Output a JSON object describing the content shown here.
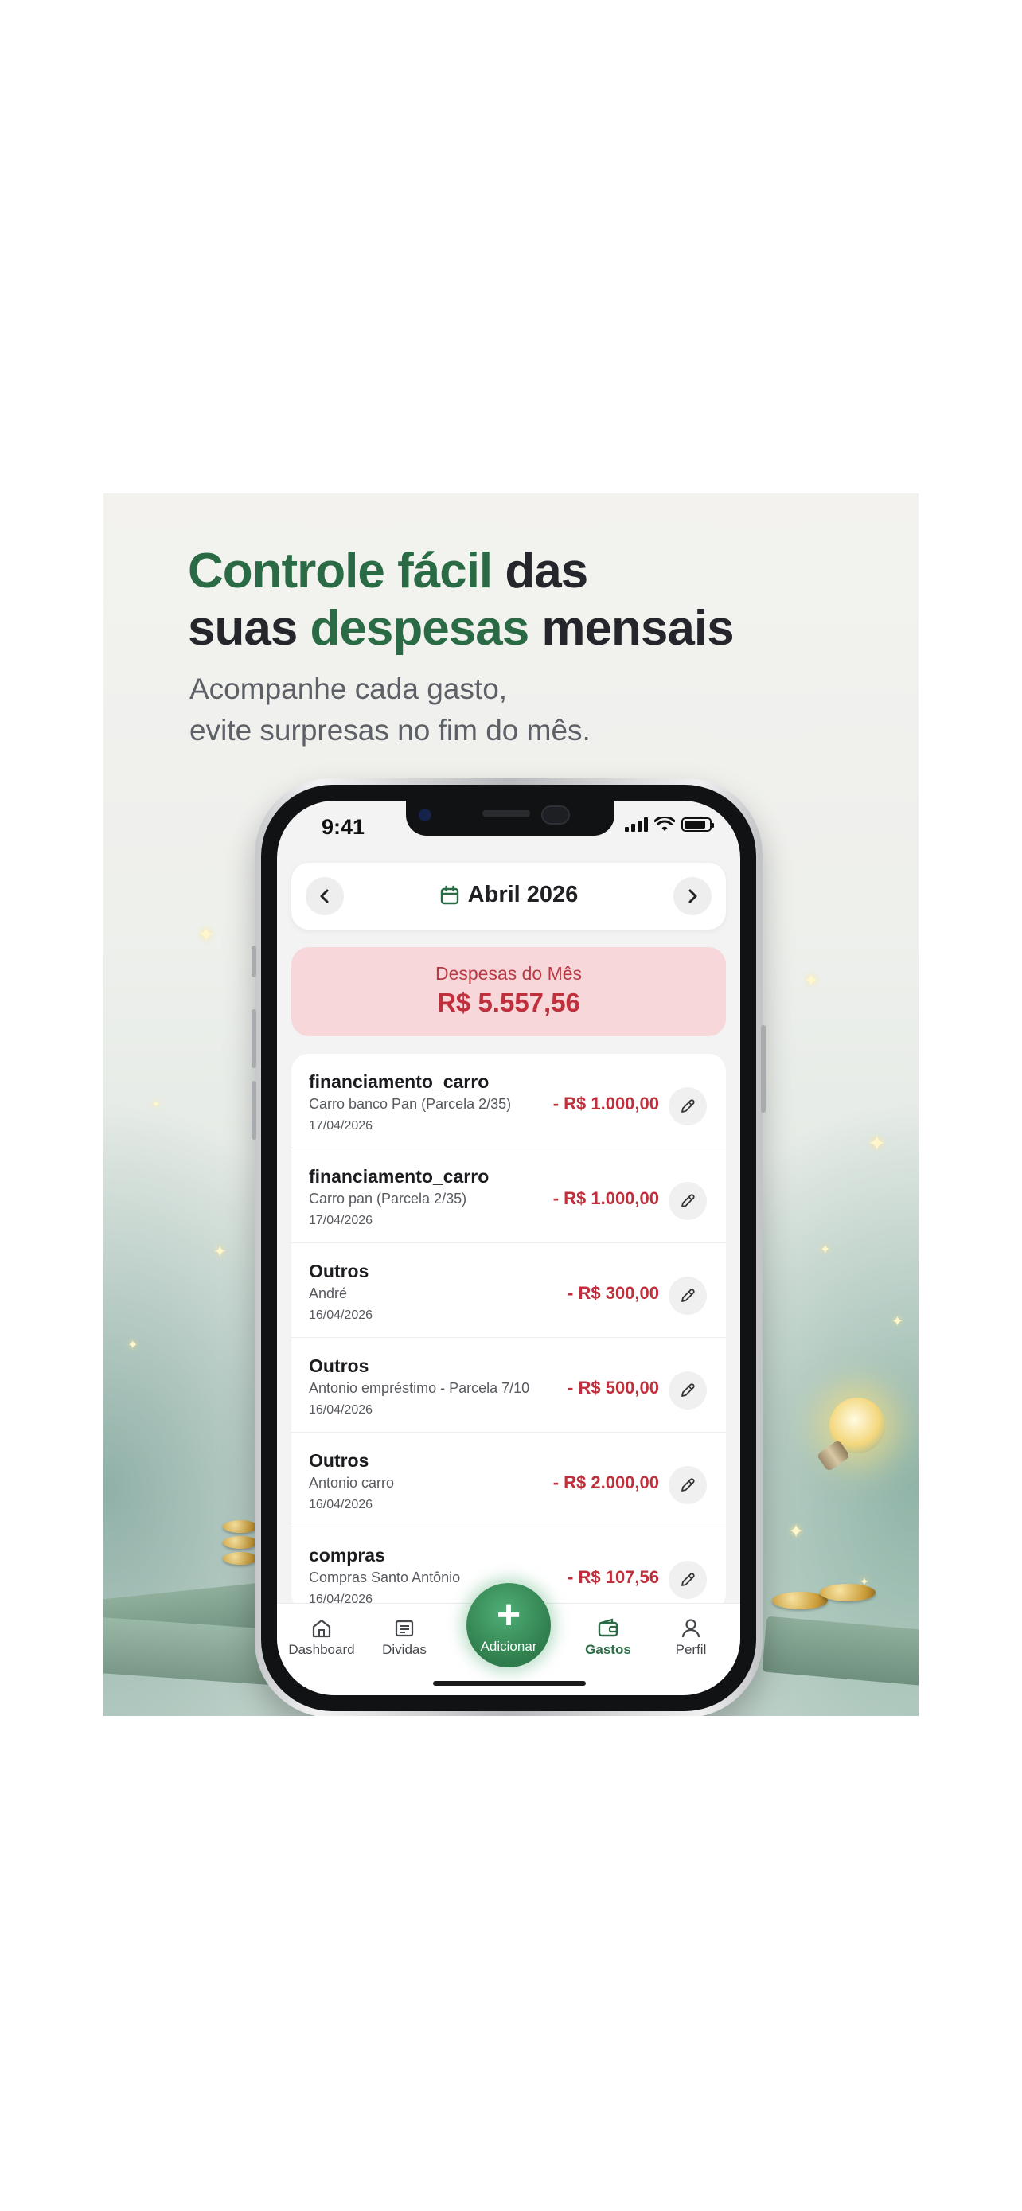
{
  "headline": {
    "line1_green": "Controle fácil",
    "line1_dark": " das",
    "line2_dark_a": "suas ",
    "line2_green": "despesas",
    "line2_dark_b": " mensais"
  },
  "subline": {
    "line1": "Acompanhe cada gasto,",
    "line2": "evite surpresas no fim do mês."
  },
  "status_bar": {
    "time": "9:41"
  },
  "month_nav": {
    "prev_icon": "chevron-left-icon",
    "next_icon": "chevron-right-icon",
    "calendar_icon": "calendar-icon",
    "label": "Abril 2026"
  },
  "summary": {
    "label": "Despesas do Mês",
    "amount": "R$ 5.557,56"
  },
  "expenses": [
    {
      "category": "financiamento_carro",
      "description": "Carro banco Pan (Parcela 2/35)",
      "date": "17/04/2026",
      "amount": "- R$ 1.000,00"
    },
    {
      "category": "financiamento_carro",
      "description": "Carro pan (Parcela 2/35)",
      "date": "17/04/2026",
      "amount": "- R$ 1.000,00"
    },
    {
      "category": "Outros",
      "description": "André",
      "date": "16/04/2026",
      "amount": "- R$ 300,00"
    },
    {
      "category": "Outros",
      "description": "Antonio empréstimo - Parcela 7/10",
      "date": "16/04/2026",
      "amount": "- R$ 500,00"
    },
    {
      "category": "Outros",
      "description": "Antonio carro",
      "date": "16/04/2026",
      "amount": "- R$ 2.000,00"
    },
    {
      "category": "compras",
      "description": "Compras Santo Antônio",
      "date": "16/04/2026",
      "amount": "- R$ 107,56"
    }
  ],
  "tabbar": {
    "dashboard": "Dashboard",
    "dividas": "Dividas",
    "adicionar": "Adicionar",
    "adicionar_symbol": "+",
    "gastos": "Gastos",
    "perfil": "Perfil",
    "active": "gastos"
  },
  "colors": {
    "brand_green": "#2a6b45",
    "expense_red": "#c0303c",
    "summary_bg": "#f7d7d9"
  }
}
